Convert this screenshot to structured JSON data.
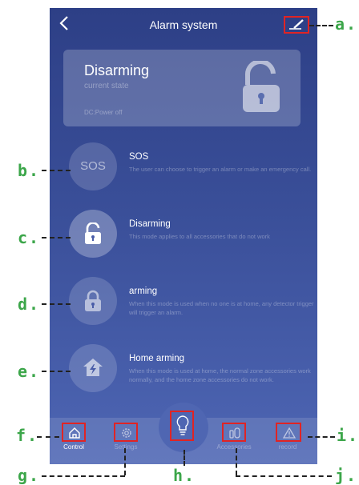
{
  "header": {
    "back_icon": "chevron-left-icon",
    "title": "Alarm system",
    "edit_icon": "pencil-icon"
  },
  "status_card": {
    "title": "Disarming",
    "subtitle": "current state",
    "power_text": "DC:Power off",
    "icon": "unlocked-padlock-icon"
  },
  "modes": [
    {
      "key": "sos",
      "title": "SOS",
      "icon_text": "SOS",
      "description": "The user can choose to trigger an alarm or make an emergency call."
    },
    {
      "key": "disarming",
      "title": "Disarming",
      "icon": "unlock-icon",
      "description": "This mode applies to all accessories that do not work"
    },
    {
      "key": "arming",
      "title": "arming",
      "icon": "lock-icon",
      "description": "When this mode is used when no one is at home, any detector trigger will trigger an alarm."
    },
    {
      "key": "home-arming",
      "title": "Home arming",
      "icon": "home-lightning-icon",
      "description": "When this mode is used at home, the normal zone accessories work normally, and the home zone accessories do not work."
    }
  ],
  "tabs": [
    {
      "label": "Control",
      "icon": "home-icon",
      "active": true
    },
    {
      "label": "Settings",
      "icon": "gear-icon",
      "active": false
    },
    {
      "label": "Accessories",
      "icon": "sensor-icon",
      "active": false
    },
    {
      "label": "record",
      "icon": "warning-icon",
      "active": false
    }
  ],
  "center_button": {
    "icon": "lightbulb-icon"
  },
  "annotations": {
    "a": "a.",
    "b": "b.",
    "c": "c.",
    "d": "d.",
    "e": "e.",
    "f": "f.",
    "g": "g.",
    "h": "h.",
    "i": "i.",
    "j": "j."
  },
  "colors": {
    "background_top": "#2d3f86",
    "background_bottom": "#4e66b4",
    "highlight_box": "#e02424",
    "annotation_label": "#3ca64a"
  }
}
